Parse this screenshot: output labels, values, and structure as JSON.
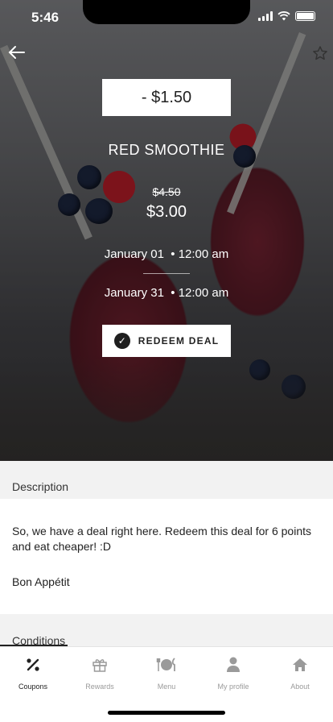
{
  "status": {
    "time": "5:46"
  },
  "deal": {
    "discount": "- $1.50",
    "title": "RED SMOOTHIE",
    "old_price": "$4.50",
    "new_price": "$3.00",
    "start": "January 01  • 12:00 am",
    "end": "January 31  • 12:00 am",
    "redeem_label": "REDEEM DEAL"
  },
  "description": {
    "heading": "Description",
    "text": "So, we have a deal right here. Redeem this deal for 6 points and eat cheaper! :D",
    "signoff": "Bon Appétit"
  },
  "conditions": {
    "heading": "Conditions"
  },
  "tabbar": {
    "items": [
      {
        "label": "Coupons",
        "icon": "percent-icon",
        "active": true
      },
      {
        "label": "Rewards",
        "icon": "gift-icon",
        "active": false
      },
      {
        "label": "Menu",
        "icon": "cutlery-icon",
        "active": false
      },
      {
        "label": "My profile",
        "icon": "user-icon",
        "active": false
      },
      {
        "label": "About",
        "icon": "home-icon",
        "active": false
      }
    ]
  },
  "colors": {
    "active_tab": "#222222",
    "inactive_tab": "#9a9a9a"
  }
}
